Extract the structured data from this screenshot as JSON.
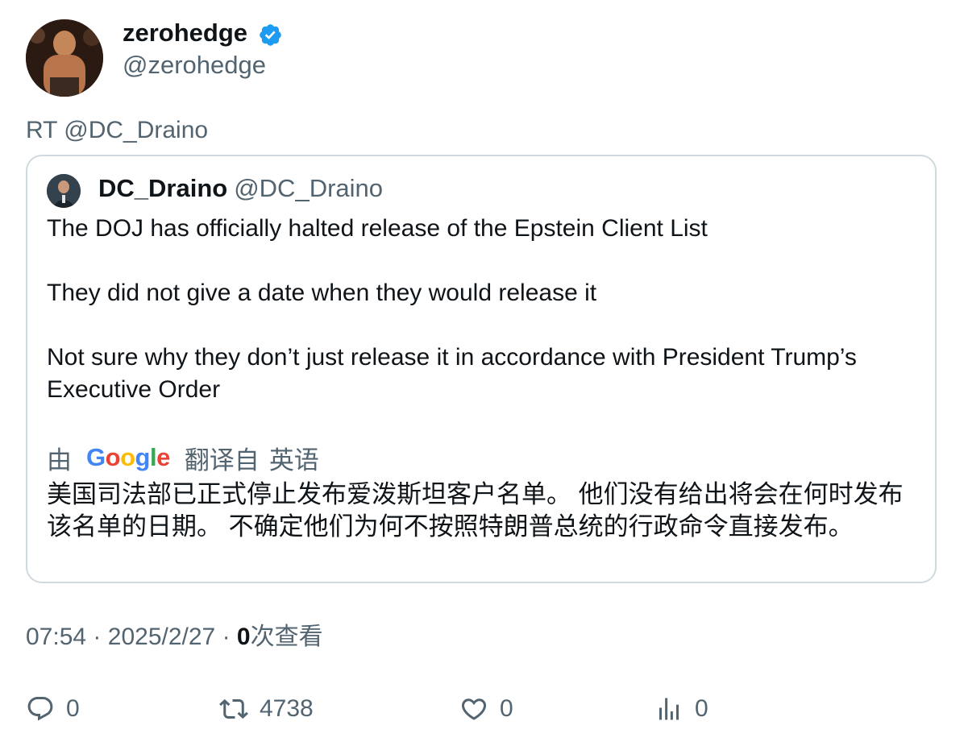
{
  "author": {
    "display_name": "zerohedge",
    "handle": "@zerohedge",
    "verified_color": "#1d9bf0"
  },
  "retweet_prefix": "RT @DC_Draino",
  "quoted": {
    "display_name": "DC_Draino",
    "handle": "@DC_Draino",
    "paragraphs": [
      "The DOJ has officially halted release of the Epstein Client List",
      "They did not give a date when they would release it",
      "Not sure why they don’t just release it in accordance with President Trump’s Executive Order"
    ],
    "translation": {
      "by_label": "由",
      "provider_logo_text": "Google",
      "from_label": "翻译自",
      "language": "英语",
      "text": "美国司法部已正式停止发布爱泼斯坦客户名单。 他们没有给出将会在何时发布该名单的日期。 不确定他们为何不按照特朗普总统的行政命令直接发布。"
    }
  },
  "meta": {
    "time": "07:54",
    "separator": "·",
    "date": "2025/2/27",
    "view_count": "0",
    "view_label": "次查看"
  },
  "actions": {
    "reply_count": "0",
    "retweet_count": "4738",
    "like_count": "0",
    "view_count": "0"
  },
  "colors": {
    "text_primary": "#0f1419",
    "text_secondary": "#536471",
    "border": "#cfd9de",
    "brand_blue": "#1d9bf0"
  }
}
